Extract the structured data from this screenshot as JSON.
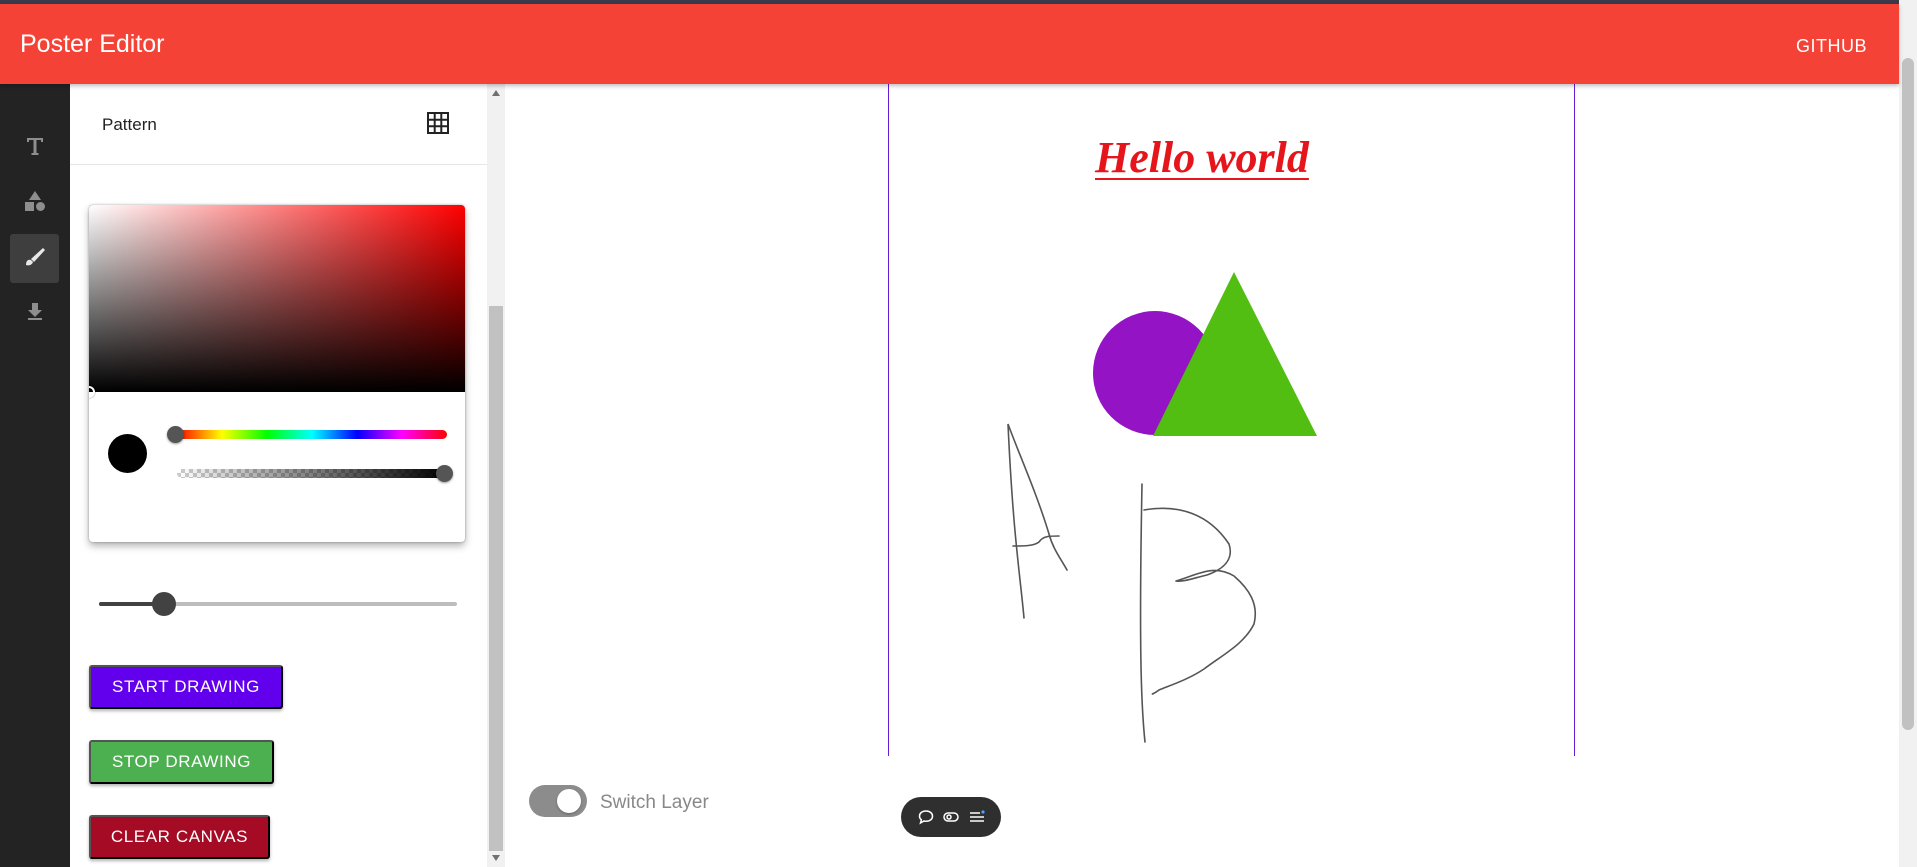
{
  "app": {
    "title": "Poster Editor",
    "github_label": "GITHUB",
    "accent_color": "#f44336"
  },
  "toolbar": {
    "items": [
      {
        "name": "text-tool",
        "icon": "text-icon",
        "active": false
      },
      {
        "name": "shapes-tool",
        "icon": "shapes-icon",
        "active": false
      },
      {
        "name": "draw-tool",
        "icon": "brush-icon",
        "active": true
      },
      {
        "name": "download-tool",
        "icon": "download-icon",
        "active": false
      }
    ]
  },
  "panel": {
    "pattern_label": "Pattern",
    "pattern_icon": "grid-icon",
    "color_picker": {
      "selected_color": "#000000",
      "hue": 0,
      "alpha": 1
    },
    "brush_size_fraction": 0.18,
    "buttons": {
      "start": "START DRAWING",
      "stop": "STOP DRAWING",
      "clear": "CLEAR CANVAS"
    },
    "button_colors": {
      "start": "#6200ee",
      "stop": "#4caf50",
      "clear": "#a50b24"
    }
  },
  "canvas": {
    "heading": "Hello world",
    "heading_color": "#e6141b",
    "shapes": [
      {
        "type": "circle",
        "color": "#9413c4"
      },
      {
        "type": "triangle",
        "color": "#52be12"
      }
    ],
    "freehand": "A B"
  },
  "layer_switch": {
    "label": "Switch Layer",
    "on": true
  },
  "floating_toolbar": {
    "icons": [
      "comment-icon",
      "toggle-icon",
      "menu-icon"
    ]
  }
}
